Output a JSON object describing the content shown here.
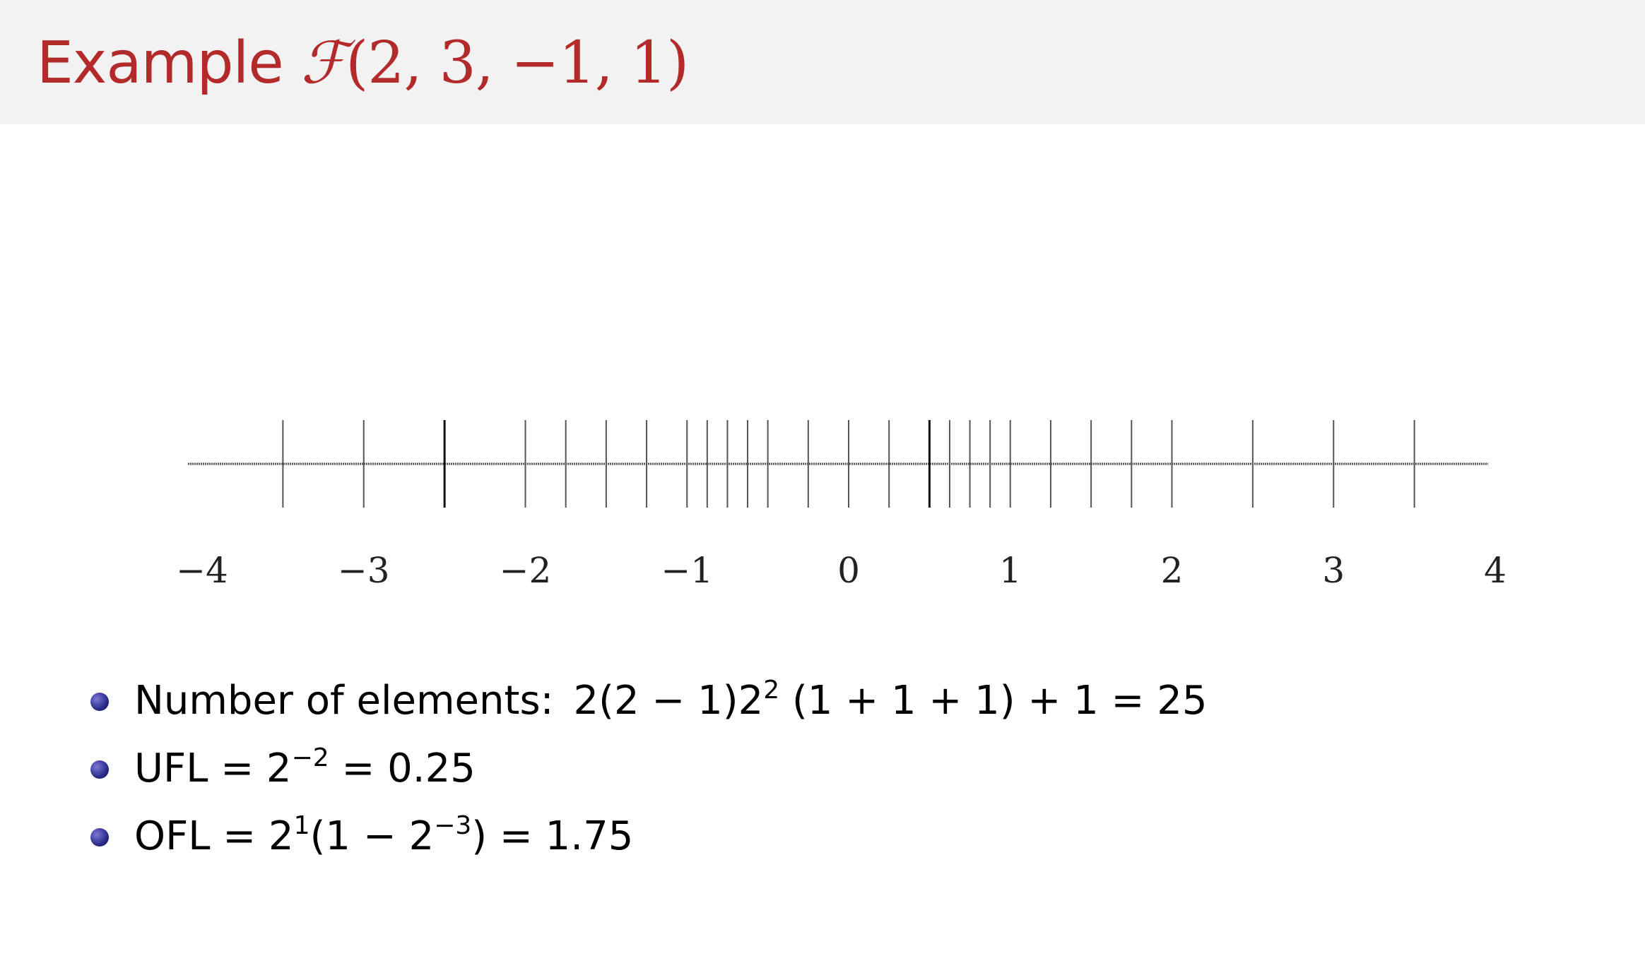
{
  "title": {
    "word": "Example",
    "symbol": "ℱ",
    "args": "(2, 3, −1, 1)"
  },
  "chart_data": {
    "type": "number-line",
    "xlim": [
      -4,
      4
    ],
    "tick_labels": [
      "−4",
      "−3",
      "−2",
      "−1",
      "0",
      "1",
      "2",
      "3",
      "4"
    ],
    "points": [
      -3.5,
      -3,
      -2.5,
      -2,
      -1.75,
      -1.5,
      -1.25,
      -1,
      -0.875,
      -0.75,
      -0.625,
      -0.5,
      -0.25,
      0,
      0.25,
      0.5,
      0.625,
      0.75,
      0.875,
      1,
      1.25,
      1.5,
      1.75,
      2,
      2.5,
      3,
      3.5
    ],
    "emphasized_points": [
      -2.5,
      0.5
    ]
  },
  "bullets": [
    {
      "label": "Number of elements:",
      "math_pre": "2(2 − 1)2",
      "math_sup": "2",
      "math_post": " (1 + 1 + 1) + 1 = 25"
    },
    {
      "label": "UFL",
      "math_pre": " = 2",
      "math_sup": "−2",
      "math_post": " = 0.25"
    },
    {
      "label": "OFL",
      "math_pre": " = 2",
      "math_sup": "1",
      "math_mid": "(1 − 2",
      "math_sup2": "−3",
      "math_post": ") = 1.75"
    }
  ]
}
